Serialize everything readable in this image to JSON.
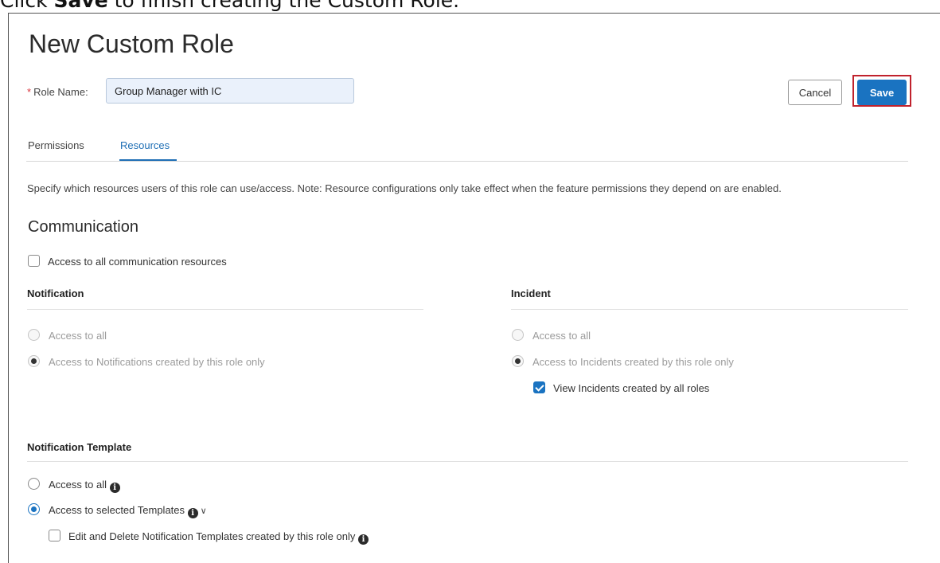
{
  "caption": {
    "prefix": "Click ",
    "bold": "Save",
    "suffix": " to finish creating the Custom Role."
  },
  "page": {
    "title": "New Custom Role"
  },
  "role_name": {
    "label": "Role Name",
    "separator": ":",
    "required_mark": "*",
    "value": "Group Manager with IC"
  },
  "buttons": {
    "cancel": "Cancel",
    "save": "Save"
  },
  "tabs": [
    {
      "label": "Permissions",
      "active": false
    },
    {
      "label": "Resources",
      "active": true
    }
  ],
  "description": "Specify which resources users of this role can use/access. Note: Resource configurations only take effect when the feature permissions they depend on are enabled.",
  "communication": {
    "title": "Communication",
    "access_all_label": "Access to all communication resources",
    "access_all_checked": false
  },
  "notification": {
    "heading": "Notification",
    "options": [
      {
        "label": "Access to all",
        "selected": false,
        "disabled": true
      },
      {
        "label": "Access to Notifications created by this role only",
        "selected": true,
        "disabled": true
      }
    ]
  },
  "incident": {
    "heading": "Incident",
    "options": [
      {
        "label": "Access to all",
        "selected": false,
        "disabled": true
      },
      {
        "label": "Access to Incidents created by this role only",
        "selected": true,
        "disabled": true
      }
    ],
    "view_all": {
      "label": "View Incidents created by all roles",
      "checked": true
    }
  },
  "notification_template": {
    "heading": "Notification Template",
    "options": [
      {
        "label": "Access to all",
        "selected": false
      },
      {
        "label": "Access to selected Templates",
        "selected": true
      }
    ],
    "edit_delete": {
      "label": "Edit and Delete Notification Templates created by this role only",
      "checked": false
    }
  },
  "icons": {
    "info": "info-icon",
    "chevron": "chevron-down-icon",
    "info_glyph": "i",
    "chevron_glyph": "∨"
  },
  "colors": {
    "accent": "#1a73c1",
    "highlight_box": "#c0222d",
    "required": "#d9363e"
  }
}
